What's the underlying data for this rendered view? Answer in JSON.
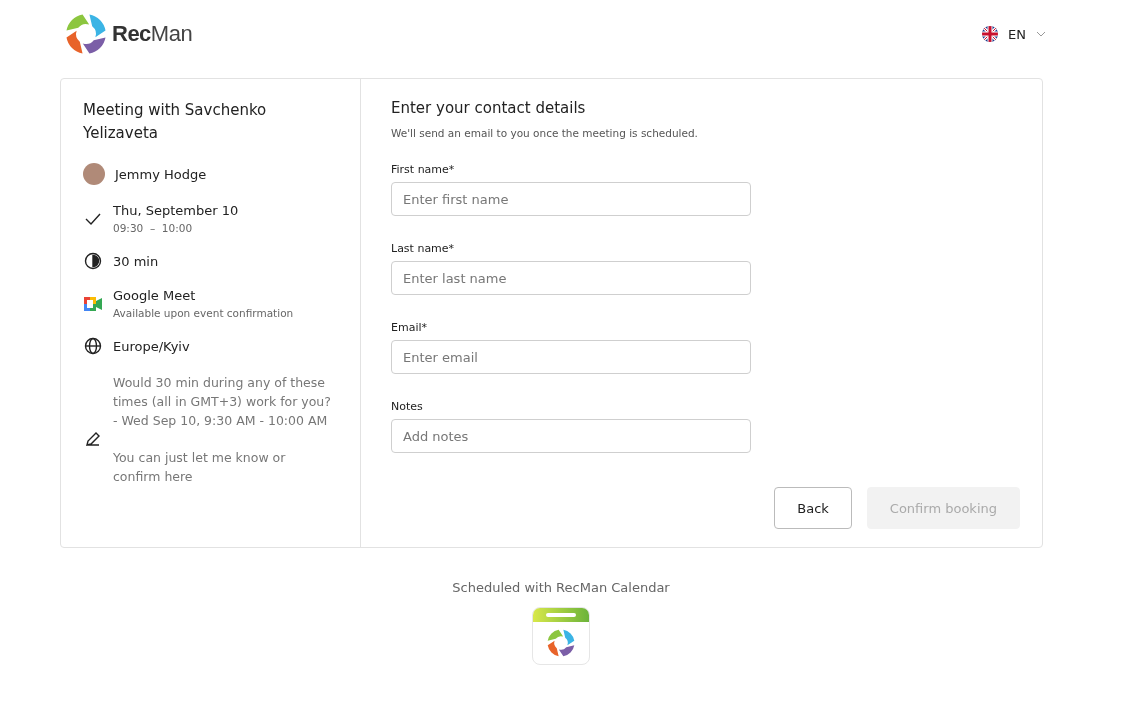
{
  "header": {
    "logo_text": "**Rec**Man",
    "language": "EN"
  },
  "meeting": {
    "title": "Meeting with Savchenko Yelizaveta",
    "host": "Jemmy Hodge",
    "date": "Thu, September 10",
    "time": "09:30  –  10:00",
    "duration": "30 min",
    "location": "Google Meet",
    "location_note": "Available upon event confirmation",
    "timezone": "Europe/Kyiv",
    "notes": [
      "Would 30 min during any of these times (all in GMT+3) work for you?\n- Wed Sep 10, 9:30 AM - 10:00 AM",
      "You can just let me know or confirm here"
    ]
  },
  "form": {
    "title": "Enter your contact details",
    "subtitle": "We'll send an email to you once the meeting is scheduled.",
    "fields": [
      {
        "label": "First name*",
        "placeholder": "Enter first name"
      },
      {
        "label": "Last name*",
        "placeholder": "Enter last name"
      },
      {
        "label": "Email*",
        "placeholder": "Enter email"
      },
      {
        "label": "Notes",
        "placeholder": "Add notes"
      }
    ],
    "buttons": [
      {
        "label": "Back",
        "kind": "secondary",
        "disabled": false
      },
      {
        "label": "Confirm booking",
        "kind": "primary",
        "disabled": true
      }
    ]
  },
  "footer": {
    "text": "Scheduled with RecMan Calendar"
  }
}
